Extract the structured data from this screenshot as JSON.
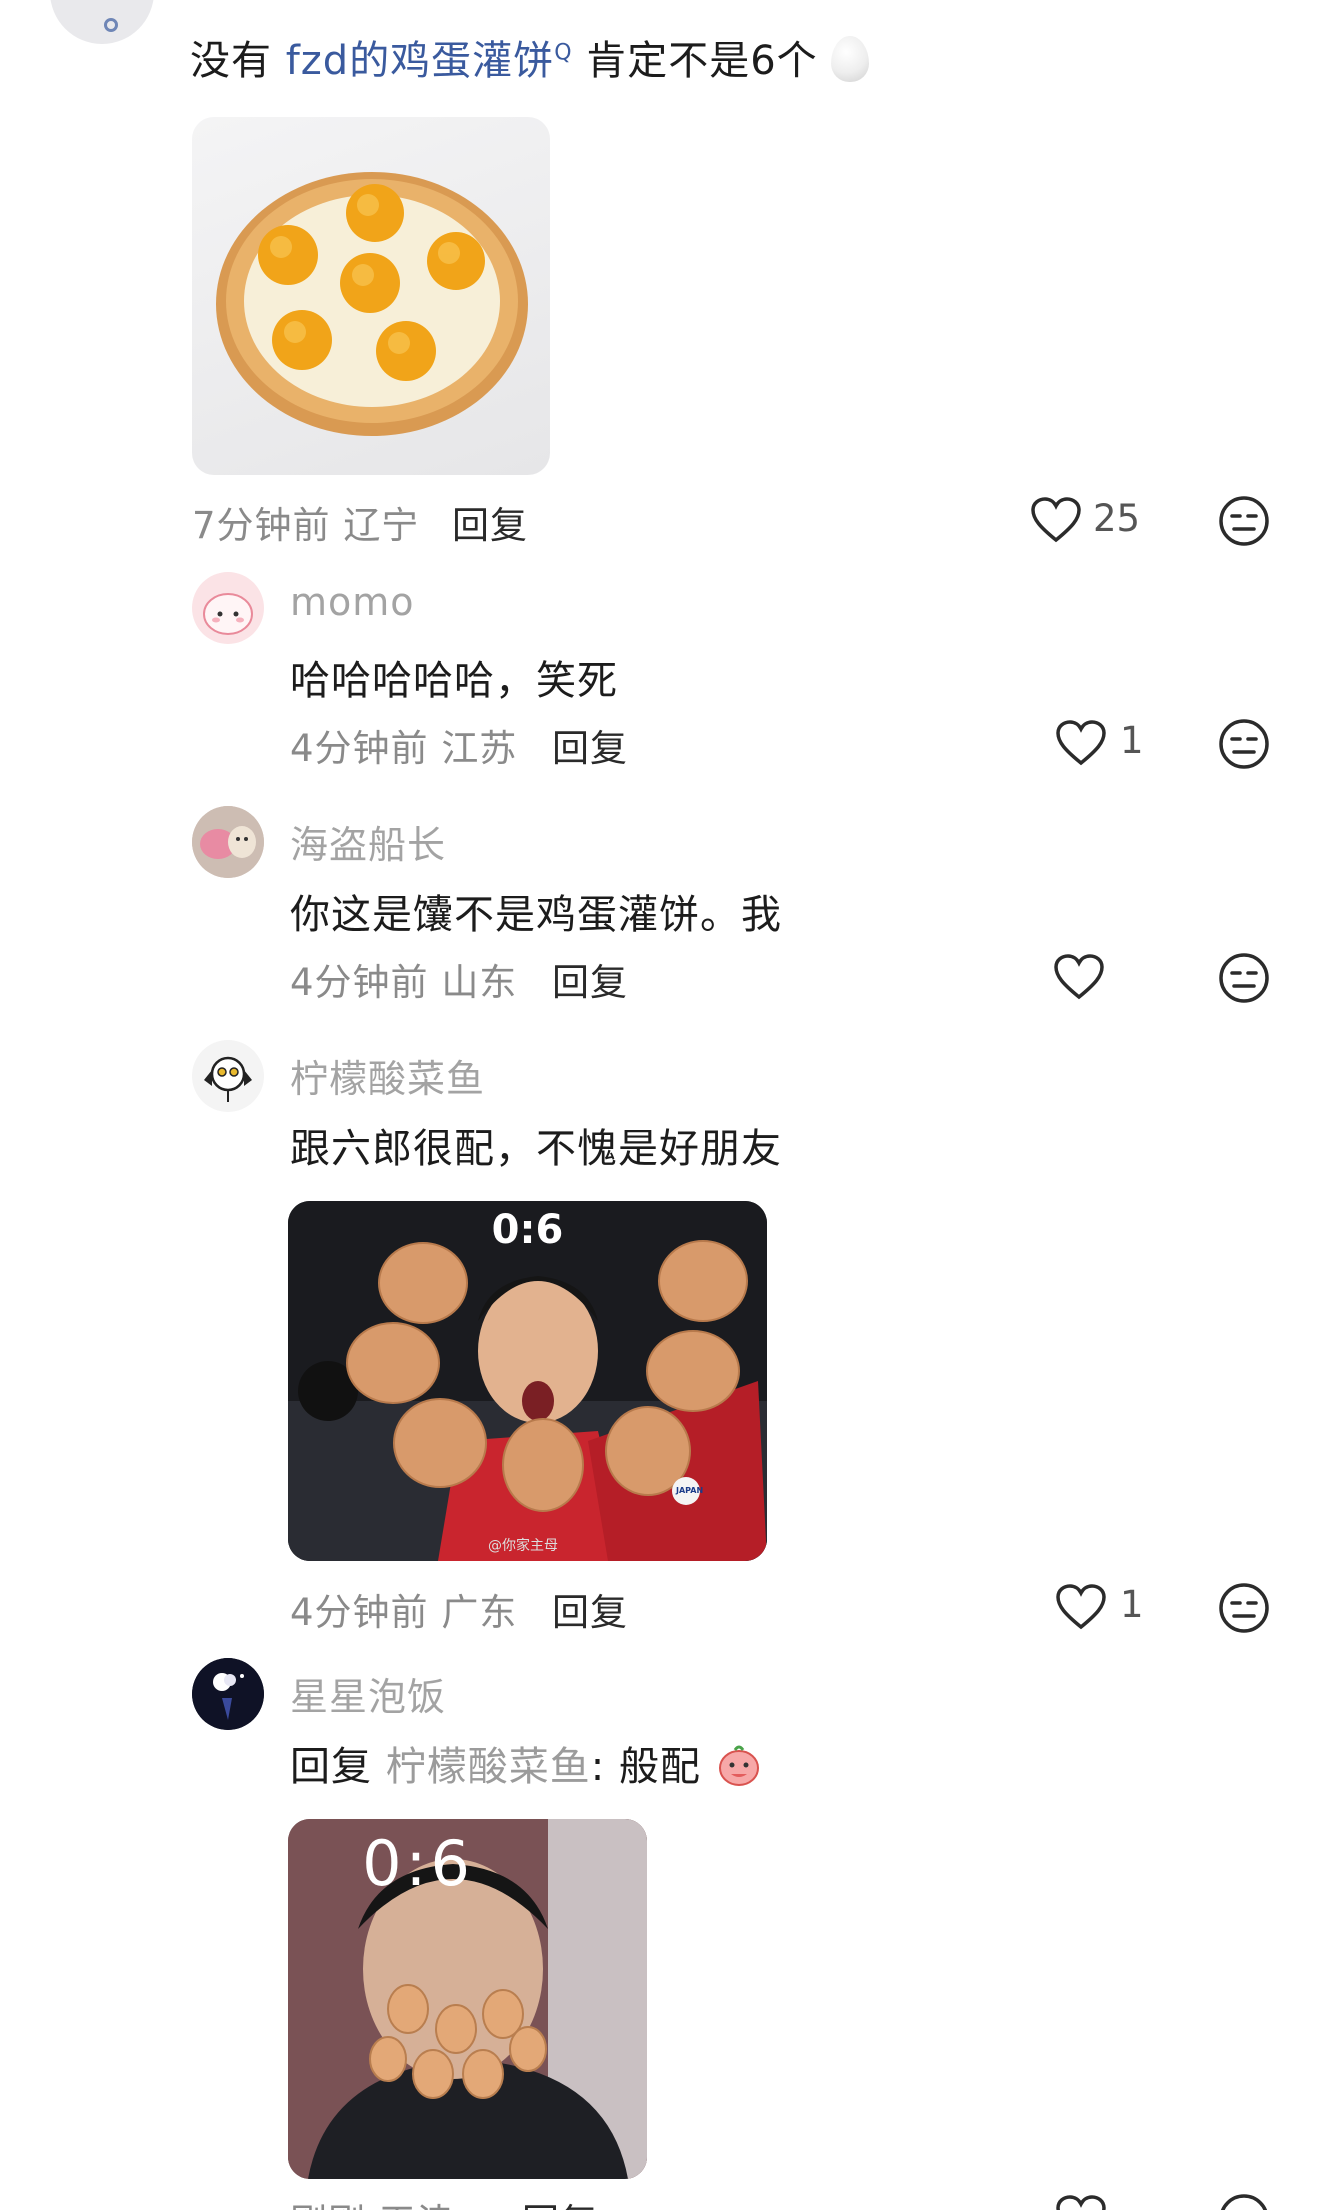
{
  "top_comment": {
    "text_prefix": "没有 ",
    "link_text": "fzd的鸡蛋灌饼",
    "link_search_mark": "Q",
    "text_suffix": " 肯定不是6个",
    "egg_emoji": "egg-emoji",
    "image": "fried-egg-pizza-photo",
    "time": "7分钟前",
    "location": "辽宁",
    "reply_label": "回复",
    "likes": "25"
  },
  "replies": [
    {
      "username": "momo",
      "text": "哈哈哈哈哈，笑死",
      "time": "4分钟前",
      "location": "江苏",
      "reply_label": "回复",
      "likes": "1"
    },
    {
      "username": "海盗船长",
      "text": "你这是馕不是鸡蛋灌饼。我",
      "time": "4分钟前",
      "location": "山东",
      "reply_label": "回复",
      "likes": ""
    },
    {
      "username": "柠檬酸菜鱼",
      "text": "跟六郎很配，不愧是好朋友",
      "image_caption": "0:6",
      "image_watermark": "@你家主母",
      "image_badge": "JAPAN",
      "time": "4分钟前",
      "location": "广东",
      "reply_label": "回复",
      "likes": "1"
    },
    {
      "username": "星星泡饭",
      "reply_prefix": "回复 ",
      "mention": "柠檬酸菜鱼",
      "text": ": 般配",
      "image_caption": "0:6",
      "time": "刚刚",
      "location": "天津",
      "reply_label": "回复"
    }
  ],
  "icons": {
    "like": "heart-outline-icon",
    "dislike": "neutral-face-icon"
  },
  "colors": {
    "link": "#3a5a9e",
    "username": "#a3a3a3",
    "meta": "#8a8a8a",
    "background": "#ffffff"
  }
}
